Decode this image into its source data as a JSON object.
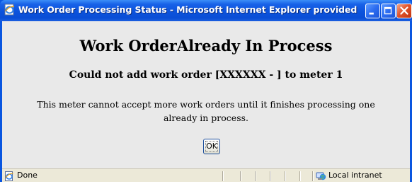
{
  "window": {
    "title": "Work Order Processing Status - Microsoft Internet Explorer provided by Gra...",
    "minimize_label": "Minimize",
    "maximize_label": "Maximize",
    "close_label": "Close"
  },
  "content": {
    "heading": "Work OrderAlready In Process",
    "subheading": "Could not add work order [XXXXXX - ] to meter 1",
    "message": "This meter cannot accept more work orders until it finishes processing one already in process.",
    "ok_label": "OK"
  },
  "statusbar": {
    "status": "Done",
    "zone": "Local intranet"
  },
  "icons": {
    "title": "ie-page-icon",
    "status": "ie-page-icon",
    "zone": "local-intranet-icon"
  },
  "colors": {
    "titlebar": "#0a56e0",
    "close_button": "#e0542d",
    "client_background": "#e9e9e9",
    "statusbar_background": "#ece9d8"
  }
}
